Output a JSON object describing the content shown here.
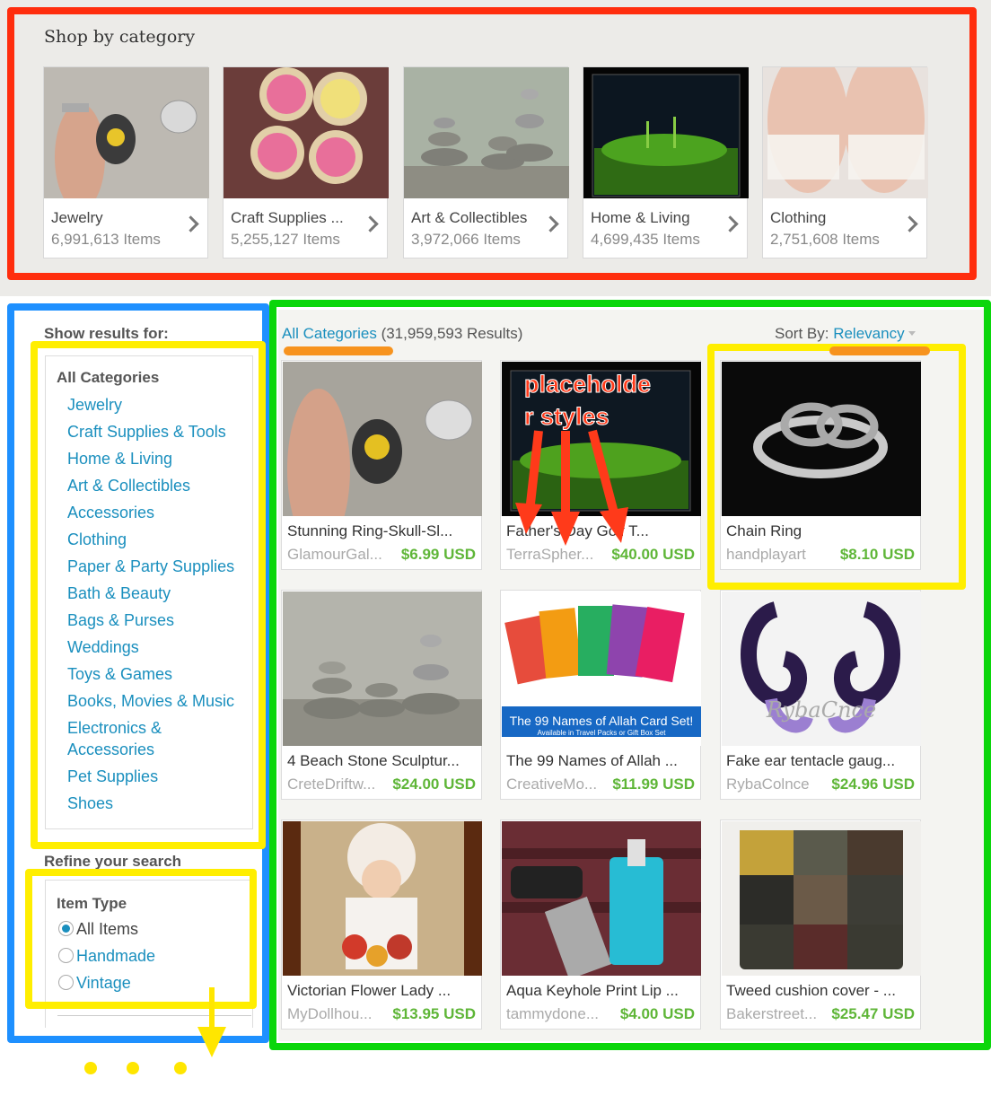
{
  "shop_by_category": {
    "title": "Shop by category",
    "categories": [
      {
        "name": "Jewelry",
        "count": "6,991,613 Items"
      },
      {
        "name": "Craft Supplies ...",
        "count": "5,255,127 Items"
      },
      {
        "name": "Art & Collectibles",
        "count": "3,972,066 Items"
      },
      {
        "name": "Home & Living",
        "count": "4,699,435 Items"
      },
      {
        "name": "Clothing",
        "count": "2,751,608 Items"
      }
    ]
  },
  "sidebar": {
    "show_results_label": "Show results for:",
    "all_categories": "All Categories",
    "categories": [
      "Jewelry",
      "Craft Supplies & Tools",
      "Home & Living",
      "Art & Collectibles",
      "Accessories",
      "Clothing",
      "Paper & Party Supplies",
      "Bath & Beauty",
      "Bags & Purses",
      "Weddings",
      "Toys & Games",
      "Books, Movies & Music",
      "Electronics & Accessories",
      "Pet Supplies",
      "Shoes"
    ],
    "refine_label": "Refine your search",
    "item_type_title": "Item Type",
    "item_types": [
      "All Items",
      "Handmade",
      "Vintage"
    ],
    "selected_item_type": "All Items"
  },
  "results": {
    "category_link": "All Categories",
    "count_text": "(31,959,593 Results)",
    "sort_label": "Sort By:",
    "sort_value": "Relevancy",
    "items": [
      {
        "title": "Stunning Ring-Skull-Sl...",
        "shop": "GlamourGal...",
        "price": "$6.99 USD"
      },
      {
        "title": "Father's Day Golf T...",
        "shop": "TerraSpher...",
        "price": "$40.00 USD"
      },
      {
        "title": "Chain Ring",
        "shop": "handplayart",
        "price": "$8.10 USD"
      },
      {
        "title": "4 Beach Stone Sculptur...",
        "shop": "CreteDriftw...",
        "price": "$24.00 USD"
      },
      {
        "title": "The 99 Names of Allah ...",
        "shop": "CreativeMo...",
        "price": "$11.99 USD"
      },
      {
        "title": "Fake ear tentacle gaug...",
        "shop": "RybaColnce",
        "price": "$24.96 USD"
      },
      {
        "title": "Victorian Flower Lady ...",
        "shop": "MyDollhou...",
        "price": "$13.95 USD"
      },
      {
        "title": "Aqua Keyhole Print Lip ...",
        "shop": "tammydone...",
        "price": "$4.00 USD"
      },
      {
        "title": "Tweed cushion cover - ...",
        "shop": "Bakerstreet...",
        "price": "$25.47 USD"
      }
    ]
  },
  "thumb_texts": {
    "allah_banner": "The 99 Names of Allah Card Set!",
    "allah_sub": "Available in Travel Packs or Gift Box Set",
    "ryba_watermark": "RybaCnce"
  },
  "annotation": {
    "text_line1": "placeholde",
    "text_line2": "r styles"
  },
  "colors": {
    "link": "#1a8fbe",
    "price": "#5fb638",
    "annotation_red": "#ff2d0d",
    "annotation_yellow": "#ffee00",
    "annotation_green": "#0bd60b",
    "annotation_blue": "#1e90ff",
    "annotation_orange": "#f7931e"
  }
}
